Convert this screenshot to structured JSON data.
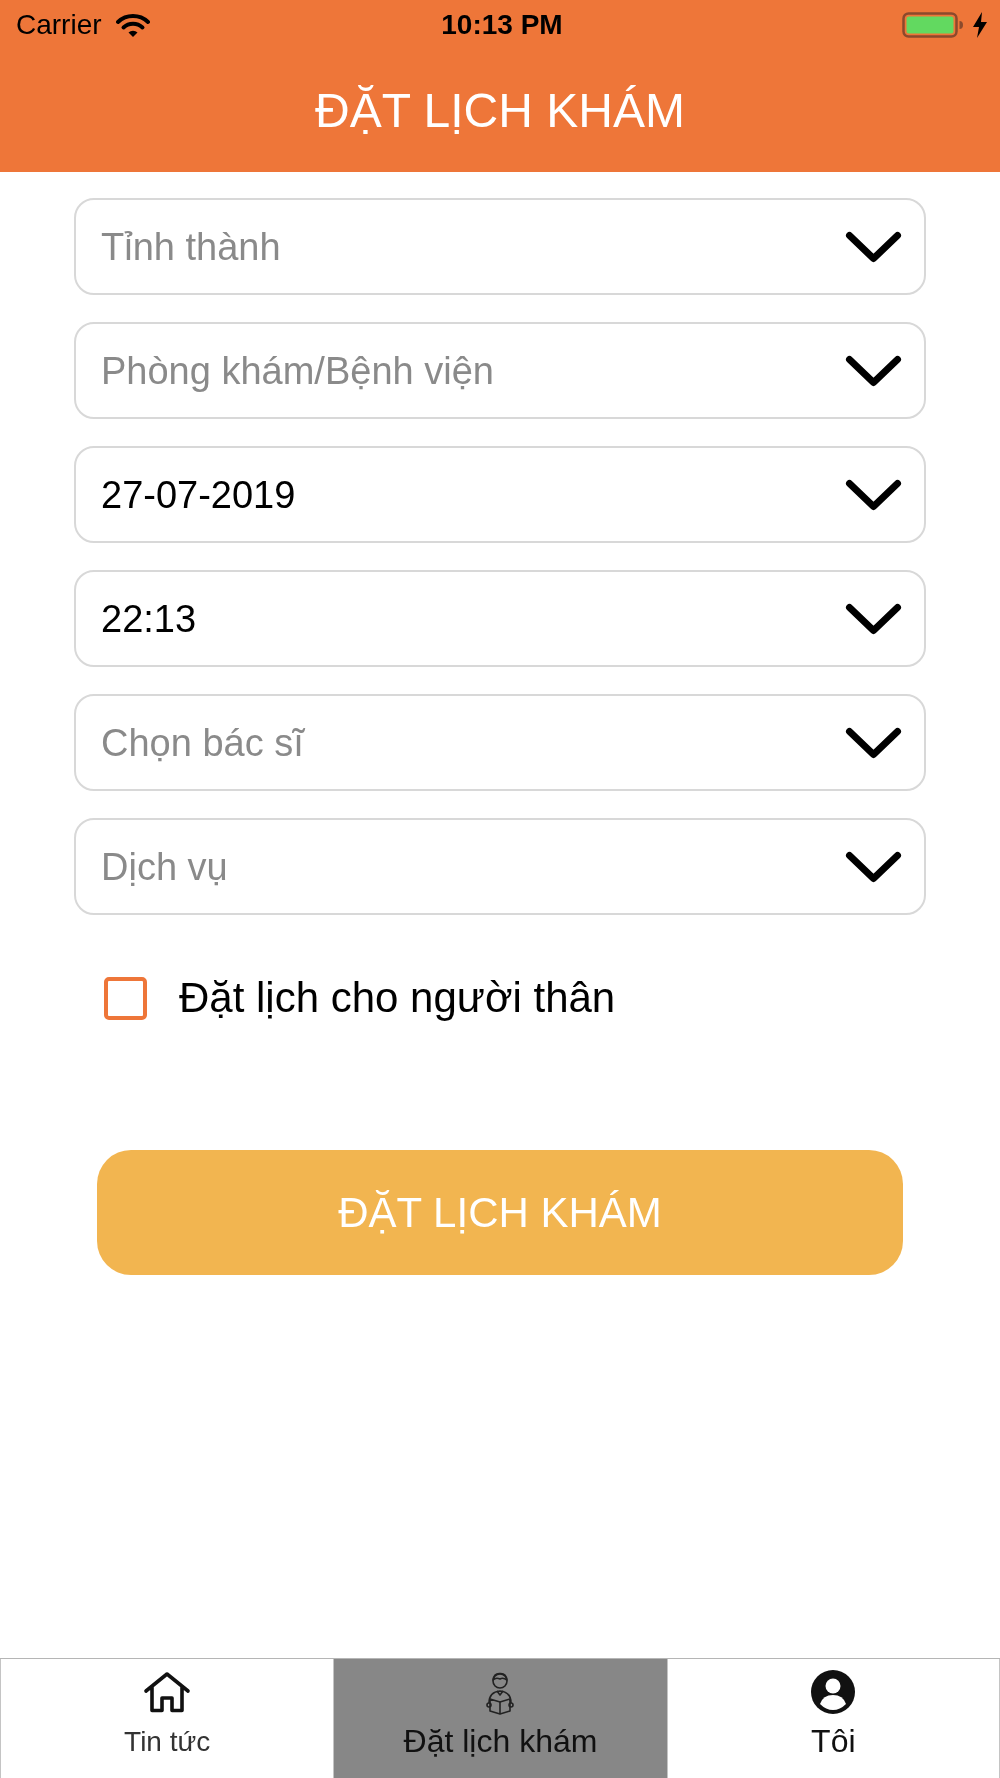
{
  "status_bar": {
    "carrier": "Carrier",
    "time": "10:13 PM"
  },
  "header": {
    "title": "ĐẶT LỊCH KHÁM"
  },
  "form": {
    "fields": [
      {
        "placeholder": "Tỉnh thành"
      },
      {
        "placeholder": "Phòng khám/Bệnh viện"
      },
      {
        "value": "27-07-2019"
      },
      {
        "value": "22:13"
      },
      {
        "placeholder": "Chọn bác sĩ"
      },
      {
        "placeholder": "Dịch vụ"
      }
    ],
    "relative_checkbox": {
      "label": "Đặt lịch cho người thân",
      "checked": false
    },
    "submit_button": {
      "label": "ĐẶT LỊCH KHÁM"
    }
  },
  "tab_bar": {
    "tabs": [
      {
        "label": "Tin tức",
        "selected": false
      },
      {
        "label": "Đặt lịch khám",
        "selected": true
      },
      {
        "label": "Tôi",
        "selected": false
      }
    ]
  }
}
